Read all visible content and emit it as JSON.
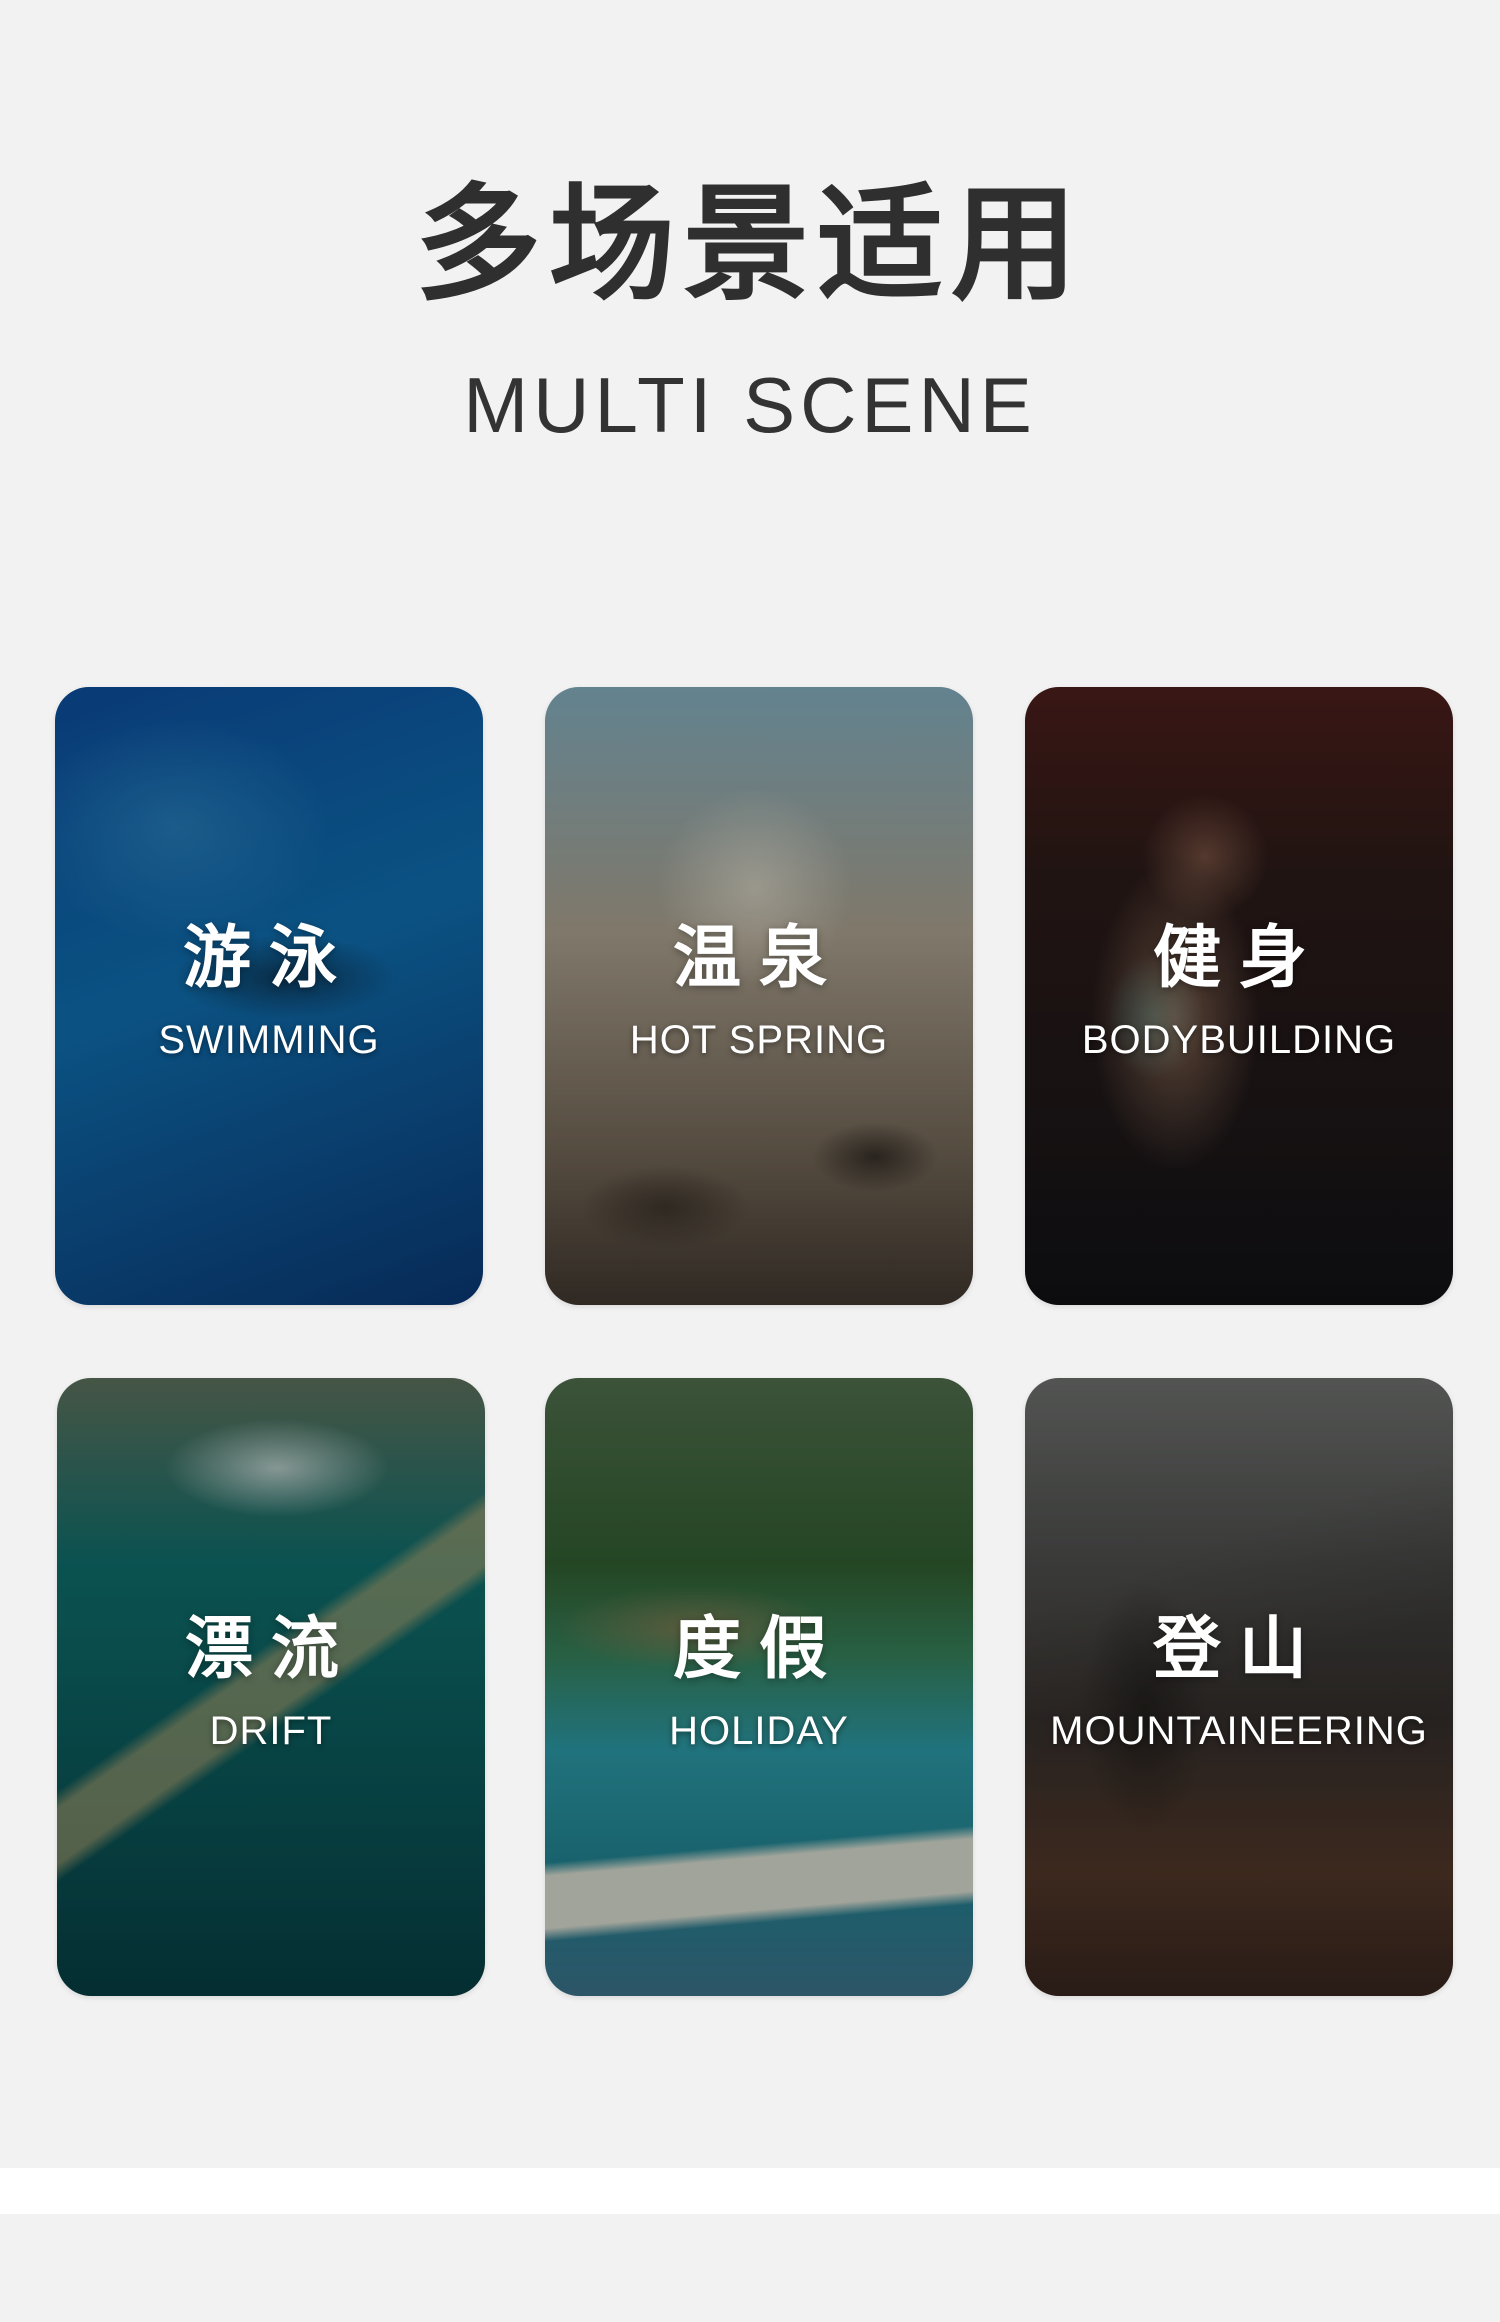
{
  "header": {
    "title": "多场景适用",
    "subtitle": "MULTI SCENE"
  },
  "cards": [
    {
      "title": "游泳",
      "subtitle": "SWIMMING",
      "image": "swimmer-in-pool",
      "colors": [
        "#0b3f86",
        "#0f6aa8",
        "#0a3670"
      ]
    },
    {
      "title": "温泉",
      "subtitle": "HOT SPRING",
      "image": "steaming-hot-spring",
      "colors": [
        "#7fa0a8",
        "#8b8479",
        "#4a4038"
      ]
    },
    {
      "title": "健身",
      "subtitle": "BODYBUILDING",
      "image": "woman-lifting-dumbbells",
      "colors": [
        "#2a1a18",
        "#6b4a3e",
        "#1b1718"
      ]
    },
    {
      "title": "漂流",
      "subtitle": "DRIFT",
      "image": "bamboo-raft-on-river",
      "colors": [
        "#3e6a6a",
        "#0e5b5c",
        "#063b40"
      ]
    },
    {
      "title": "度假",
      "subtitle": "HOLIDAY",
      "image": "tropical-overwater-bungalows",
      "colors": [
        "#345a34",
        "#2e8c90",
        "#d7d0bf"
      ]
    },
    {
      "title": "登山",
      "subtitle": "MOUNTAINEERING",
      "image": "hikers-on-mountain",
      "colors": [
        "#4b4d4d",
        "#3a3431",
        "#5b3e2e"
      ]
    }
  ]
}
